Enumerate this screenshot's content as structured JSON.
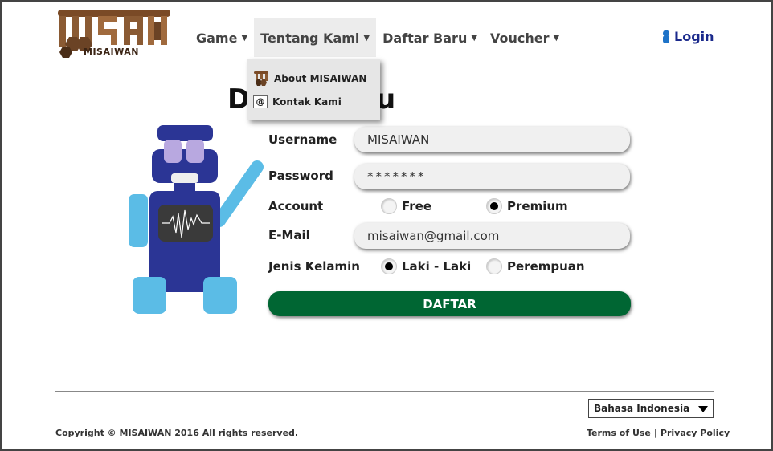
{
  "brand": {
    "name": "MISAIWAN"
  },
  "nav": {
    "items": [
      {
        "label": "Game"
      },
      {
        "label": "Tentang Kami"
      },
      {
        "label": "Daftar Baru"
      },
      {
        "label": "Voucher"
      }
    ],
    "login_label": "Login",
    "dropdown": [
      {
        "label": "About MISAIWAN",
        "icon": "misaiwan-logo-icon"
      },
      {
        "label": "Kontak Kami",
        "icon": "at-icon"
      }
    ]
  },
  "page": {
    "title_left": "D",
    "title_right": "u"
  },
  "form": {
    "username": {
      "label": "Username",
      "value": "MISAIWAN"
    },
    "password": {
      "label": "Password",
      "value": "*******"
    },
    "account": {
      "label": "Account",
      "options": [
        "Free",
        "Premium"
      ],
      "selected": "Premium"
    },
    "email": {
      "label": "E-Mail",
      "value": "misaiwan@gmail.com"
    },
    "gender": {
      "label": "Jenis Kelamin",
      "options": [
        "Laki - Laki",
        "Perempuan"
      ],
      "selected": "Laki - Laki"
    },
    "submit_label": "DAFTAR"
  },
  "footer": {
    "language": "Bahasa Indonesia",
    "copyright": "Copyright © MISAIWAN 2016 All rights reserved.",
    "terms": "Terms of Use",
    "privacy": "Privacy Policy"
  },
  "colors": {
    "brand_brown": "#8a5a33",
    "brand_dark": "#3b2414",
    "submit_green": "#006633",
    "robot_navy": "#2b3595",
    "robot_light_blue": "#5bbce6",
    "robot_lavender": "#b8a8e0",
    "login_blue": "#1b2a8c"
  }
}
